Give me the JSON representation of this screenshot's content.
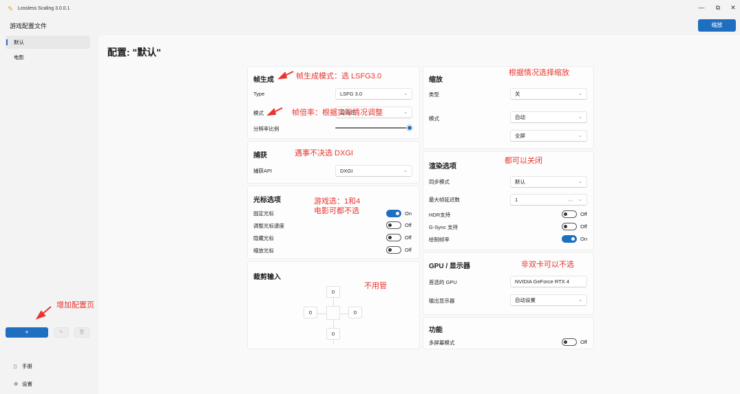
{
  "window": {
    "title": "Lossless Scaling 3.0.0.1",
    "minimize": "—",
    "maximize": "⧉",
    "close": "✕"
  },
  "header": {
    "left_title": "游戏配置文件",
    "scale_button": "缩放"
  },
  "sidebar": {
    "profiles": [
      {
        "label": "默认",
        "active": true
      },
      {
        "label": "电影",
        "active": false
      }
    ],
    "add_label": "+",
    "edit_icon": "pencil-icon",
    "delete_icon": "trash-icon",
    "bottom": [
      {
        "label": "手册",
        "icon": "book-icon"
      },
      {
        "label": "设置",
        "icon": "gear-icon"
      }
    ]
  },
  "page": {
    "title": "配置: \"默认\""
  },
  "frame_gen": {
    "title": "帧生成",
    "type_label": "Type",
    "type_value": "LSFG 3.0",
    "mode_label": "模式",
    "mode_value": "自适应",
    "resolution_label": "分辨率比例",
    "resolution_value": 1.0
  },
  "capture": {
    "title": "捕获",
    "api_label": "捕获API",
    "api_value": "DXGI"
  },
  "cursor": {
    "title": "光标选项",
    "items": [
      {
        "label": "固定光标",
        "state": "On",
        "on": true
      },
      {
        "label": "调整光标速度",
        "state": "Off",
        "on": false
      },
      {
        "label": "隐藏光标",
        "state": "Off",
        "on": false
      },
      {
        "label": "缩放光标",
        "state": "Off",
        "on": false
      }
    ]
  },
  "crop": {
    "title": "裁剪输入",
    "top": "0",
    "left": "0",
    "right": "0",
    "bottom": "0"
  },
  "scaling": {
    "title": "缩放",
    "type_label": "类型",
    "type_value": "关",
    "mode_label": "模式",
    "mode_value": "自动",
    "fit_value": "全屏"
  },
  "render": {
    "title": "渲染选项",
    "sync_label": "同步模式",
    "sync_value": "默认",
    "max_latency_label": "最大帧延迟数",
    "max_latency_value": "1",
    "toggles": [
      {
        "label": "HDR支持",
        "state": "Off",
        "on": false
      },
      {
        "label": "G-Sync 支持",
        "state": "Off",
        "on": false
      },
      {
        "label": "绘制帧率",
        "state": "On",
        "on": true
      }
    ]
  },
  "gpu": {
    "title": "GPU / 显示器",
    "gpu_label": "首选的 GPU",
    "gpu_value": "NVIDIA GeForce RTX 4",
    "display_label": "输出显示器",
    "display_value": "自动设置"
  },
  "features": {
    "title": "功能",
    "multi_label": "多屏幕模式",
    "multi_state": "Off"
  },
  "annotations": {
    "a1": "帧生成模式：选 LSFG3.0",
    "a2": "帧倍率：根据实际情况调整",
    "a3": "遇事不决选 DXGI",
    "a4": "游戏选：1和4",
    "a5": "电影可都不选",
    "a6": "不用管",
    "a7": "根据情况选择缩放",
    "a8": "都可以关闭",
    "a9": "非双卡可以不选",
    "a10": "增加配置页"
  },
  "colors": {
    "accent": "#1f6fc1",
    "annotation": "#e8342c"
  }
}
